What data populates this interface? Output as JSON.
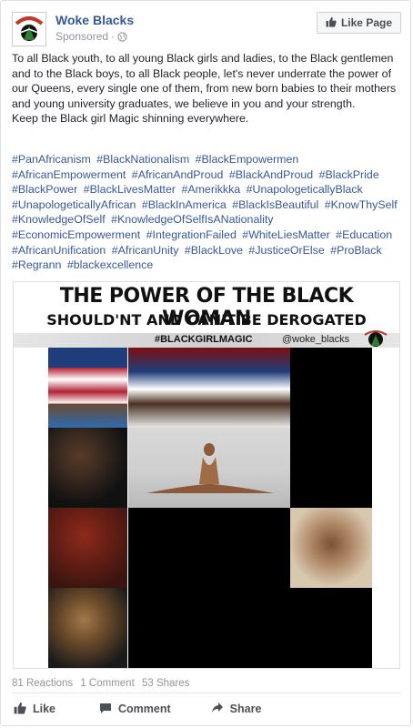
{
  "post": {
    "page_name": "Woke Blacks",
    "sponsored_label": "Sponsored",
    "like_page_label": "Like Page",
    "body_paragraph": "To all Black youth, to all young Black girls and ladies, to the Black gentlemen and to the Black boys, to all Black people, let's never underrate the power of our Queens, every single one of them, from new born babies to their mothers and young university graduates, we believe in you and your strength.",
    "body_closing": "Keep the Black girl Magic shinning everywhere.",
    "hashtags": [
      "#PanAfricanism",
      "#BlackNationalism",
      "#BlackEmpowermen",
      "#AfricanEmpowerment",
      "#AfricanAndProud",
      "#BlackAndProud",
      "#BlackPride",
      "#BlackPower",
      "#BlackLivesMatter",
      "#Amerikkka",
      "#UnapologeticallyBlack",
      "#UnapologeticallyAfrican",
      "#BlackInAmerica",
      "#BlackIsBeautiful",
      "#KnowThySelf",
      "#KnowledgeOfSelf",
      "#KnowledgeOfSelfIsANationality",
      "#EconomicEmpowerment",
      "#IntegrationFailed",
      "#WhiteLiesMatter",
      "#Education",
      "#AfricanUnification",
      "#AfricanUnity",
      "#BlackLove",
      "#JusticeOrElse",
      "#ProBlack",
      "#Regrann",
      "#blackexcellence"
    ]
  },
  "image": {
    "headline_line1": "THE POWER OF THE BLACK WOMAN",
    "headline_line2": "SHOULD'NT AND CAN'T BE DEROGATED",
    "hashtag": "#BLACKGIRLMAGIC",
    "handle": "@woke_blacks"
  },
  "stats": {
    "reactions": "81 Reactions",
    "comments": "1 Comment",
    "shares": "53 Shares"
  },
  "actions": {
    "like": "Like",
    "comment": "Comment",
    "share": "Share"
  },
  "colors": {
    "link_blue": "#365899",
    "meta_gray": "#90949c"
  }
}
